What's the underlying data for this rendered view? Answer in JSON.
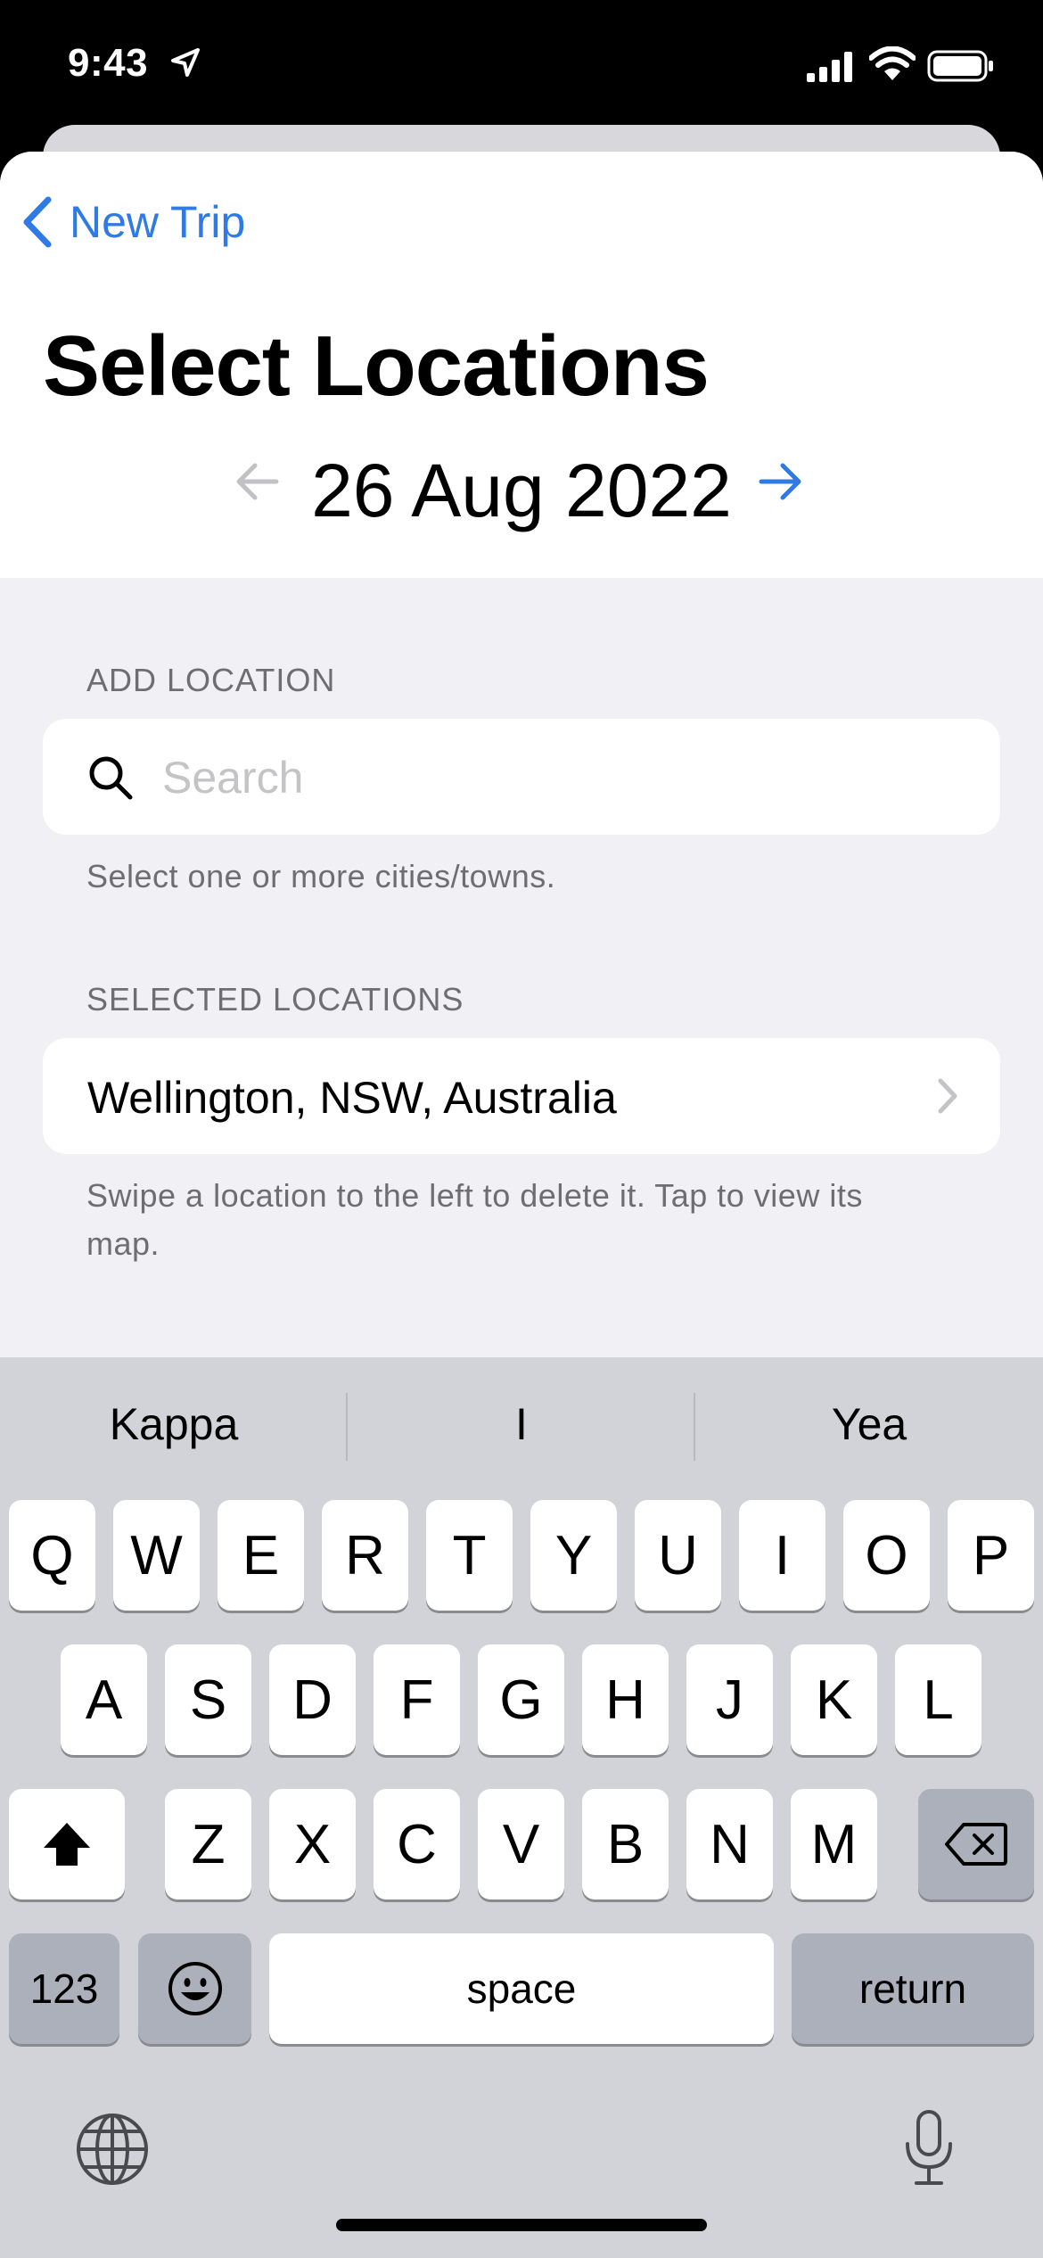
{
  "status_bar": {
    "time": "9:43"
  },
  "nav": {
    "back_label": "New Trip"
  },
  "page": {
    "title": "Select Locations"
  },
  "date_nav": {
    "date": "26 Aug 2022"
  },
  "add_location": {
    "header": "ADD LOCATION",
    "placeholder": "Search",
    "footer": "Select one or more cities/towns."
  },
  "selected_locations": {
    "header": "SELECTED LOCATIONS",
    "items": [
      {
        "label": "Wellington, NSW, Australia"
      }
    ],
    "footer": "Swipe a location to the left to delete it. Tap to view its map."
  },
  "keyboard": {
    "predictions": [
      "Kappa",
      "I",
      "Yea"
    ],
    "row1": [
      "Q",
      "W",
      "E",
      "R",
      "T",
      "Y",
      "U",
      "I",
      "O",
      "P"
    ],
    "row2": [
      "A",
      "S",
      "D",
      "F",
      "G",
      "H",
      "J",
      "K",
      "L"
    ],
    "row3": [
      "Z",
      "X",
      "C",
      "V",
      "B",
      "N",
      "M"
    ],
    "numbers_label": "123",
    "space_label": "space",
    "return_label": "return"
  },
  "colors": {
    "accent": "#2f7ae5",
    "grouped_background": "#f0f0f5",
    "keyboard_background": "#d2d3d8"
  },
  "icons": [
    "location-arrow-icon",
    "cellular-signal-icon",
    "wifi-icon",
    "battery-icon",
    "chevron-left-icon",
    "arrow-left-icon",
    "arrow-right-icon",
    "search-icon",
    "chevron-right-icon",
    "shift-icon",
    "delete-icon",
    "emoji-icon",
    "globe-icon",
    "microphone-icon"
  ]
}
